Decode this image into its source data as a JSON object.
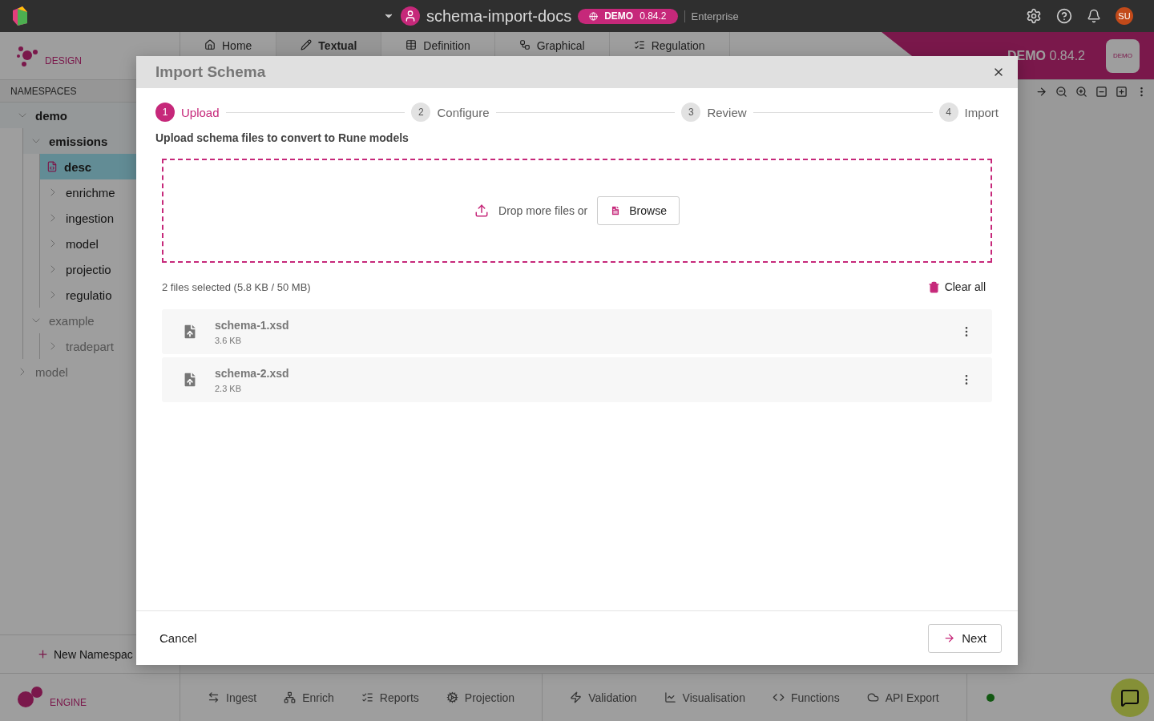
{
  "topbar": {
    "project": "schema-import-docs",
    "env_badge": "DEMO",
    "version": "0.84.2",
    "edition": "Enterprise",
    "avatar": "SU"
  },
  "design_header": {
    "logo": "DESIGN",
    "banner": "DEMO",
    "banner_version": "0.84.2",
    "banner_logo": "DEMO",
    "tabs": [
      {
        "label": "Home",
        "selected": false
      },
      {
        "label": "Textual",
        "selected": true
      },
      {
        "label": "Definition",
        "selected": false
      },
      {
        "label": "Graphical",
        "selected": false
      },
      {
        "label": "Regulation",
        "selected": false
      }
    ]
  },
  "sidebar": {
    "title": "NAMESPACES",
    "new_button": "New Namespac",
    "tree": [
      {
        "label": "demo",
        "kind": "folder",
        "expanded": true,
        "muted": false,
        "selected": false,
        "children": [
          {
            "label": "emissions",
            "kind": "folder",
            "expanded": true,
            "muted": false,
            "selected": false,
            "children": [
              {
                "label": "desc",
                "kind": "file",
                "selected": true,
                "muted": false
              },
              {
                "label": "enrichme",
                "kind": "folder",
                "expanded": false,
                "muted": false,
                "selected": false
              },
              {
                "label": "ingestion",
                "kind": "folder",
                "expanded": false,
                "muted": false,
                "selected": false
              },
              {
                "label": "model",
                "kind": "folder",
                "expanded": false,
                "muted": false,
                "selected": false
              },
              {
                "label": "projectio",
                "kind": "folder",
                "expanded": false,
                "muted": false,
                "selected": false
              },
              {
                "label": "regulatio",
                "kind": "folder",
                "expanded": false,
                "muted": false,
                "selected": false
              }
            ]
          },
          {
            "label": "example",
            "kind": "folder",
            "expanded": true,
            "muted": true,
            "selected": false,
            "children": [
              {
                "label": "tradepart",
                "kind": "folder",
                "expanded": false,
                "muted": true,
                "selected": false
              }
            ]
          }
        ]
      },
      {
        "label": "model",
        "kind": "folder",
        "expanded": false,
        "muted": true,
        "selected": false
      }
    ]
  },
  "modal": {
    "title": "Import Schema",
    "steps": [
      {
        "number": "1",
        "label": "Upload",
        "selected": true
      },
      {
        "number": "2",
        "label": "Configure",
        "selected": false
      },
      {
        "number": "3",
        "label": "Review",
        "selected": false
      },
      {
        "number": "4",
        "label": "Import",
        "selected": false
      }
    ],
    "subtitle": "Upload schema files to convert to Rune models",
    "dropzone": {
      "prompt": "Drop more files or",
      "browse": "Browse"
    },
    "summary": "2 files selected (5.8 KB / 50 MB)",
    "clear_all": "Clear all",
    "files": [
      {
        "name": "schema-1.xsd",
        "size": "3.6 KB"
      },
      {
        "name": "schema-2.xsd",
        "size": "2.3 KB"
      }
    ],
    "cancel": "Cancel",
    "next": "Next"
  },
  "bottom_bar": {
    "logo": "ENGINE",
    "groups": [
      [
        "Ingest",
        "Enrich",
        "Reports",
        "Projection"
      ],
      [
        "Validation",
        "Visualisation",
        "Functions",
        "API Export"
      ]
    ]
  }
}
